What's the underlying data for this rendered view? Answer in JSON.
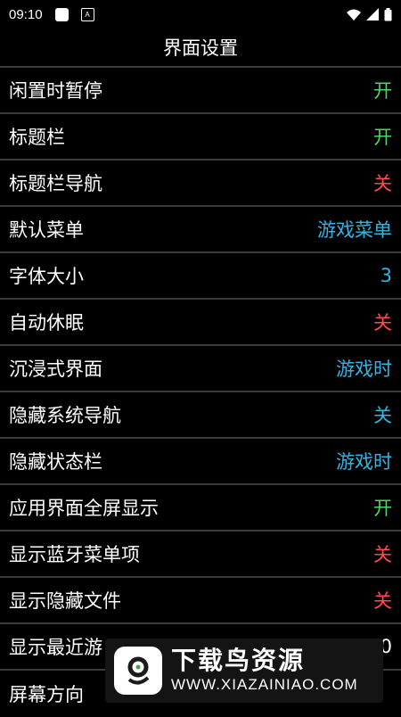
{
  "status_bar": {
    "time": "09:10",
    "notif_letter": "A"
  },
  "title": "界面设置",
  "rows": [
    {
      "label": "闲置时暂停",
      "value": "开",
      "color": "#4cd964"
    },
    {
      "label": "标题栏",
      "value": "开",
      "color": "#4cd964"
    },
    {
      "label": "标题栏导航",
      "value": "关",
      "color": "#ff4d4d"
    },
    {
      "label": "默认菜单",
      "value": "游戏菜单",
      "color": "#33b5e5"
    },
    {
      "label": "字体大小",
      "value": "3",
      "color": "#33b5e5"
    },
    {
      "label": "自动休眠",
      "value": "关",
      "color": "#ff4d4d"
    },
    {
      "label": "沉浸式界面",
      "value": "游戏时",
      "color": "#33b5e5"
    },
    {
      "label": "隐藏系统导航",
      "value": "关",
      "color": "#33b5e5"
    },
    {
      "label": "隐藏状态栏",
      "value": "游戏时",
      "color": "#33b5e5"
    },
    {
      "label": "应用界面全屏显示",
      "value": "开",
      "color": "#4cd964"
    },
    {
      "label": "显示蓝牙菜单项",
      "value": "关",
      "color": "#ff4d4d"
    },
    {
      "label": "显示隐藏文件",
      "value": "关",
      "color": "#ff4d4d"
    },
    {
      "label": "显示最近游",
      "value": "0",
      "color": "#ffffff"
    },
    {
      "label": "屏幕方向",
      "value": "",
      "color": "#ffffff"
    }
  ],
  "watermark": {
    "name": "下载鸟资源",
    "url": "WWW.XIAZAINIAO.COM"
  }
}
